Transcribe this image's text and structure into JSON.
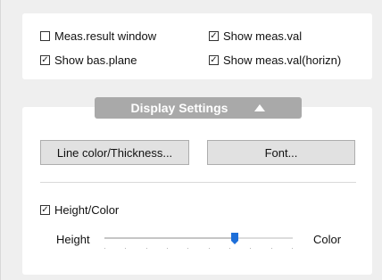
{
  "top_options": {
    "meas_result_window": {
      "label": "Meas.result window",
      "checked": false
    },
    "show_meas_val": {
      "label": "Show meas.val",
      "checked": true
    },
    "show_bas_plane": {
      "label": "Show bas.plane",
      "checked": true
    },
    "show_meas_val_horizn": {
      "label": "Show meas.val(horizn)",
      "checked": true
    }
  },
  "display_settings": {
    "title": "Display Settings",
    "line_color_button": "Line color/Thickness...",
    "font_button": "Font...",
    "height_color": {
      "label": "Height/Color",
      "checked": true
    },
    "slider": {
      "left_label": "Height",
      "right_label": "Color",
      "value_fraction": 0.69,
      "tick_count": 10
    }
  },
  "colors": {
    "accent": "#1e6fd9",
    "header_bg": "#a9a9a9"
  }
}
